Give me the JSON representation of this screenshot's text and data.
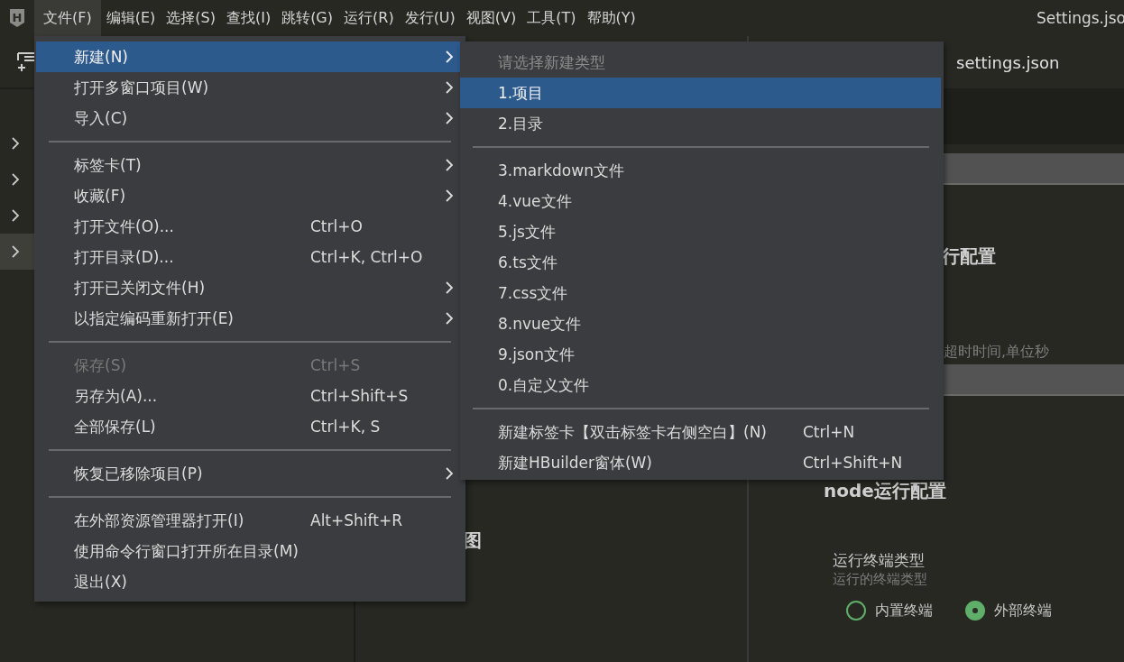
{
  "logo": {
    "letter": "H"
  },
  "menubar": {
    "items": [
      {
        "label": "文件(F)",
        "selected": true
      },
      {
        "label": "编辑(E)",
        "selected": false
      },
      {
        "label": "选择(S)",
        "selected": false
      },
      {
        "label": "查找(I)",
        "selected": false
      },
      {
        "label": "跳转(G)",
        "selected": false
      },
      {
        "label": "运行(R)",
        "selected": false
      },
      {
        "label": "发行(U)",
        "selected": false
      },
      {
        "label": "视图(V)",
        "selected": false
      },
      {
        "label": "工具(T)",
        "selected": false
      },
      {
        "label": "帮助(Y)",
        "selected": false
      }
    ],
    "title": "Settings.jso"
  },
  "explorer_rows": [
    {
      "selected": false
    },
    {
      "selected": false
    },
    {
      "selected": false
    },
    {
      "selected": true
    }
  ],
  "middle_panel": {
    "text": "图"
  },
  "settings": {
    "tab": "settings.json",
    "heading": "行配置",
    "description": "超时时间,单位秒",
    "node_heading": "node运行配置",
    "terminal_label": "运行终端类型",
    "terminal_description": "运行的终端类型",
    "terminal_options": [
      {
        "label": "内置终端",
        "selected": false
      },
      {
        "label": "外部终端",
        "selected": true
      }
    ]
  },
  "file_menu": [
    {
      "kind": "item",
      "label": "新建(N)",
      "submenu": true,
      "selected": true,
      "disabled": false
    },
    {
      "kind": "item",
      "label": "打开多窗口项目(W)",
      "submenu": true,
      "selected": false,
      "disabled": false
    },
    {
      "kind": "item",
      "label": "导入(C)",
      "submenu": true,
      "selected": false,
      "disabled": false
    },
    {
      "kind": "separator"
    },
    {
      "kind": "item",
      "label": "标签卡(T)",
      "submenu": true,
      "selected": false,
      "disabled": false
    },
    {
      "kind": "item",
      "label": "收藏(F)",
      "submenu": true,
      "selected": false,
      "disabled": false
    },
    {
      "kind": "item",
      "label": "打开文件(O)...",
      "shortcut": "Ctrl+O",
      "submenu": false,
      "selected": false,
      "disabled": false
    },
    {
      "kind": "item",
      "label": "打开目录(D)...",
      "shortcut": "Ctrl+K, Ctrl+O",
      "submenu": false,
      "selected": false,
      "disabled": false
    },
    {
      "kind": "item",
      "label": "打开已关闭文件(H)",
      "submenu": true,
      "selected": false,
      "disabled": false
    },
    {
      "kind": "item",
      "label": "以指定编码重新打开(E)",
      "submenu": true,
      "selected": false,
      "disabled": false
    },
    {
      "kind": "separator"
    },
    {
      "kind": "item",
      "label": "保存(S)",
      "shortcut": "Ctrl+S",
      "submenu": false,
      "selected": false,
      "disabled": true
    },
    {
      "kind": "item",
      "label": "另存为(A)...",
      "shortcut": "Ctrl+Shift+S",
      "submenu": false,
      "selected": false,
      "disabled": false
    },
    {
      "kind": "item",
      "label": "全部保存(L)",
      "shortcut": "Ctrl+K, S",
      "submenu": false,
      "selected": false,
      "disabled": false
    },
    {
      "kind": "separator"
    },
    {
      "kind": "item",
      "label": "恢复已移除项目(P)",
      "submenu": true,
      "selected": false,
      "disabled": false
    },
    {
      "kind": "separator"
    },
    {
      "kind": "item",
      "label": "在外部资源管理器打开(I)",
      "shortcut": "Alt+Shift+R",
      "submenu": false,
      "selected": false,
      "disabled": false
    },
    {
      "kind": "item",
      "label": "使用命令行窗口打开所在目录(M)",
      "submenu": false,
      "selected": false,
      "disabled": false
    },
    {
      "kind": "item",
      "label": "退出(X)",
      "submenu": false,
      "selected": false,
      "disabled": false
    }
  ],
  "new_submenu": [
    {
      "kind": "header",
      "label": "请选择新建类型"
    },
    {
      "kind": "item",
      "label": "1.项目",
      "selected": true
    },
    {
      "kind": "item",
      "label": "2.目录",
      "selected": false
    },
    {
      "kind": "separator"
    },
    {
      "kind": "item",
      "label": "3.markdown文件",
      "selected": false
    },
    {
      "kind": "item",
      "label": "4.vue文件",
      "selected": false
    },
    {
      "kind": "item",
      "label": "5.js文件",
      "selected": false
    },
    {
      "kind": "item",
      "label": "6.ts文件",
      "selected": false
    },
    {
      "kind": "item",
      "label": "7.css文件",
      "selected": false
    },
    {
      "kind": "item",
      "label": "8.nvue文件",
      "selected": false
    },
    {
      "kind": "item",
      "label": "9.json文件",
      "selected": false
    },
    {
      "kind": "item",
      "label": "0.自定义文件",
      "selected": false
    },
    {
      "kind": "separator"
    },
    {
      "kind": "item",
      "label": "新建标签卡【双击标签卡右侧空白】(N)",
      "shortcut": "Ctrl+N",
      "selected": false
    },
    {
      "kind": "item",
      "label": "新建HBuilder窗体(W)",
      "shortcut": "Ctrl+Shift+N",
      "selected": false
    }
  ]
}
